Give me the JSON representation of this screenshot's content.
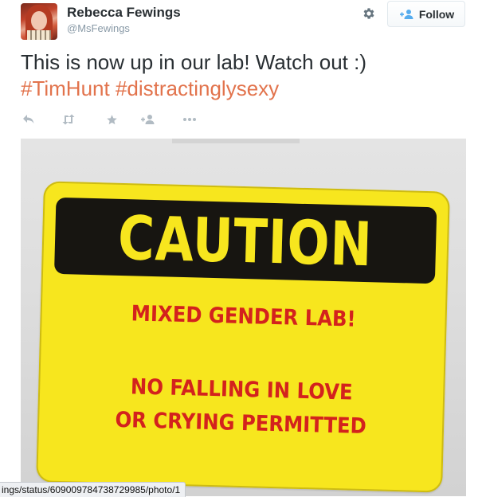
{
  "user": {
    "name": "Rebecca Fewings",
    "handle": "@MsFewings"
  },
  "header": {
    "settings_icon": "gear-icon",
    "follow_label": "Follow",
    "follow_icon": "add-user-icon"
  },
  "tweet": {
    "text": "This is now up in our lab! Watch out :)",
    "hashtags": [
      "#TimHunt",
      "#distractinglysexy"
    ]
  },
  "actions": {
    "icons": [
      "reply-icon",
      "retweet-icon",
      "favorite-icon",
      "follow-icon",
      "more-icon"
    ]
  },
  "photo": {
    "sign": {
      "headline": "CAUTION",
      "line1": "MIXED GENDER LAB!",
      "line2": "NO FALLING IN LOVE",
      "line3": "OR CRYING PERMITTED"
    }
  },
  "status_bar": {
    "url": "ings/status/609009784738729985/photo/1"
  },
  "colors": {
    "hashtag": "#e2734c",
    "sign_yellow": "#f7e61e",
    "sign_black": "#171511",
    "sign_red": "#d3221d",
    "icon_gray": "#b1bbc3"
  }
}
